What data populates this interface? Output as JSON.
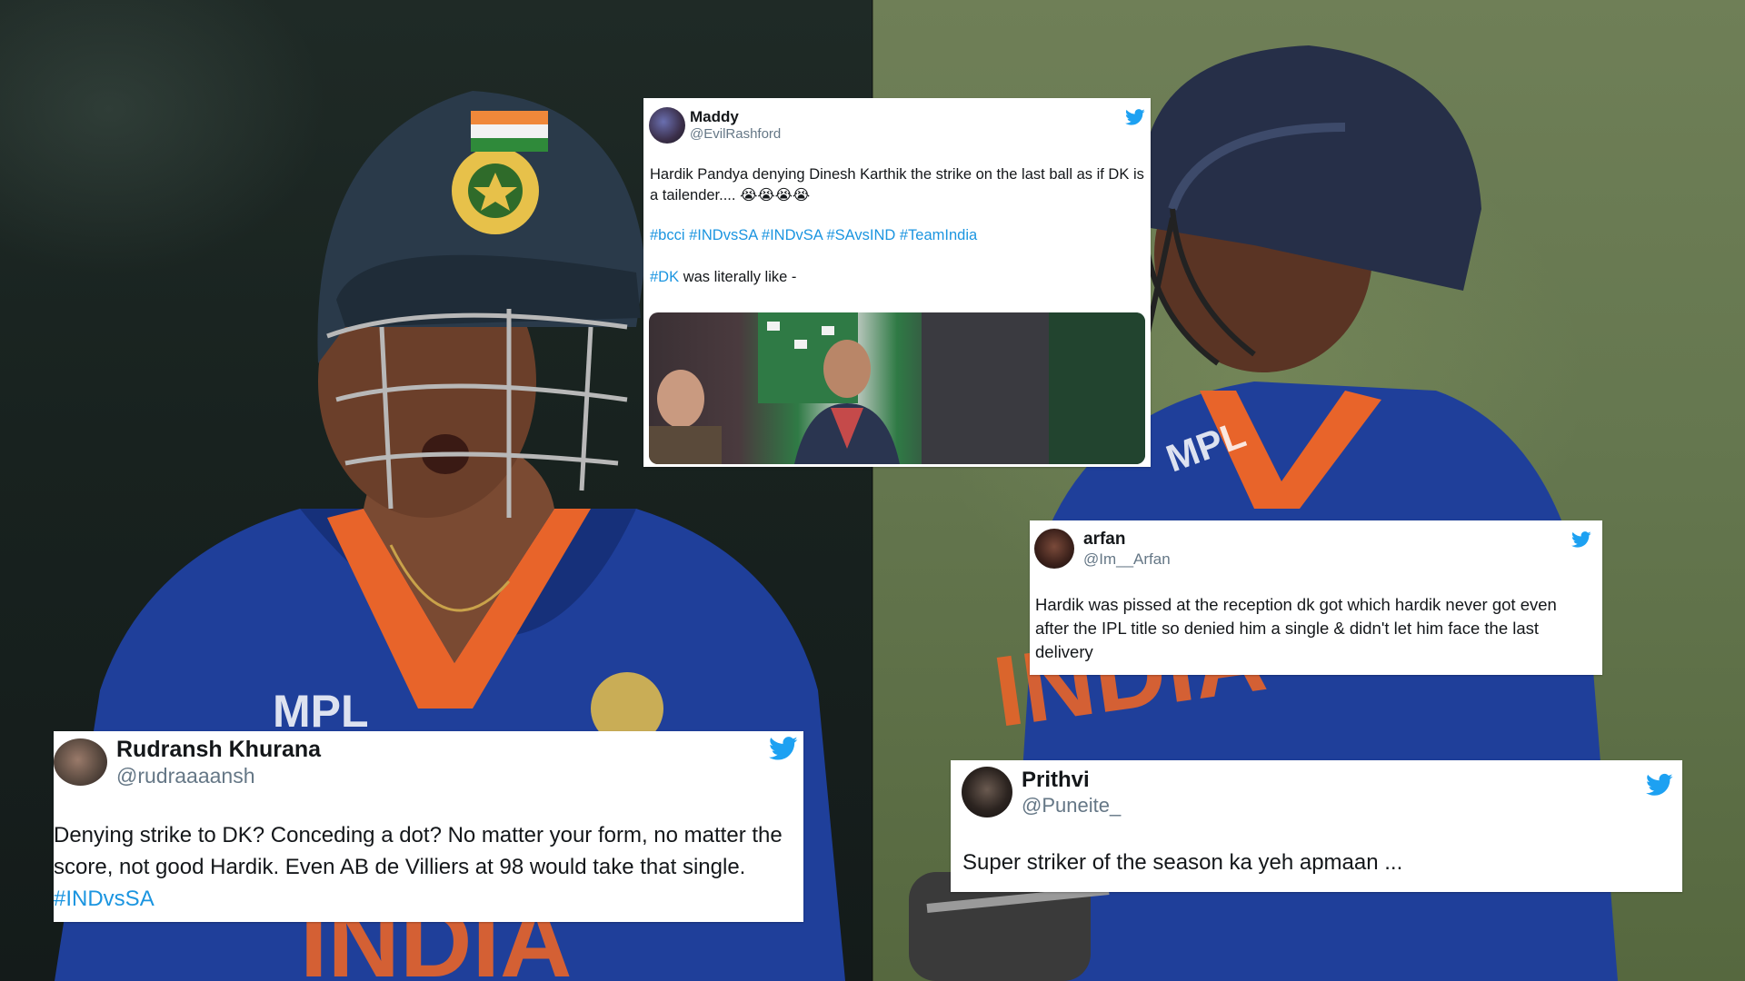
{
  "tweets": {
    "maddy": {
      "name": "Maddy",
      "handle": "@EvilRashford",
      "text": "Hardik Pandya denying Dinesh Karthik the strike on the last ball as if DK is a tailender.... 😭😭😭😭",
      "hashtags": [
        "#bcci",
        "#INDvsSA",
        "#INDvSA",
        "#SAvsIND",
        "#TeamIndia"
      ],
      "line3_tag": "#DK",
      "line3_text": " was literally like -"
    },
    "arfan": {
      "name": "arfan",
      "handle": "@Im__Arfan",
      "text": "Hardik was pissed at the reception dk got which hardik never got even after the IPL title so denied him a single & didn't let him face the last delivery"
    },
    "rudransh": {
      "name": "Rudransh Khurana",
      "handle": "@rudraaaansh",
      "text": "Denying strike to DK? Conceding a dot? No matter your form, no matter the score, not good Hardik. Even AB de Villiers at 98 would take that single. ",
      "hashtag": "#INDvsSA"
    },
    "prithvi": {
      "name": "Prithvi",
      "handle": "@Puneite_",
      "text": "Super striker of the season ka yeh apmaan ..."
    }
  },
  "colors": {
    "twitter_blue": "#1DA1F2",
    "hashtag": "#1b95e0",
    "jersey_blue": "#1f3f9a",
    "jersey_orange": "#e8642a"
  },
  "icons": [
    "twitter-bird-icon"
  ]
}
